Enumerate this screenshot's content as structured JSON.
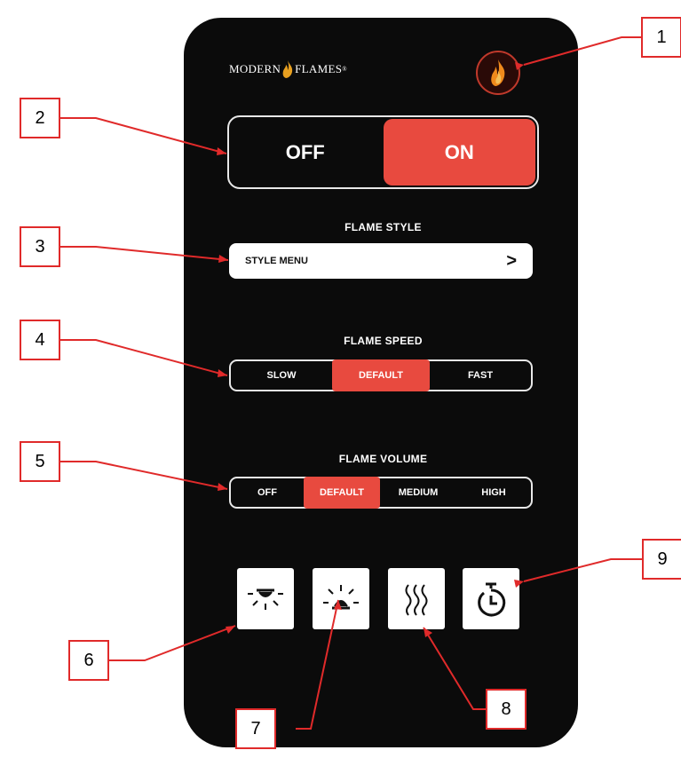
{
  "brand": {
    "left": "MODERN",
    "right": "FLAMES",
    "mark": "®"
  },
  "header": {
    "flame_button_icon": "flame-icon"
  },
  "power": {
    "off_label": "OFF",
    "on_label": "ON",
    "selected": "ON"
  },
  "flame_style": {
    "title": "FLAME STYLE",
    "menu_label": "STYLE MENU",
    "chevron": ">"
  },
  "flame_speed": {
    "title": "FLAME SPEED",
    "options": [
      "SLOW",
      "DEFAULT",
      "FAST"
    ],
    "selected": "DEFAULT"
  },
  "flame_volume": {
    "title": "FLAME VOLUME",
    "options": [
      "OFF",
      "DEFAULT",
      "MEDIUM",
      "HIGH"
    ],
    "selected": "DEFAULT"
  },
  "bottom_buttons": [
    {
      "icon": "downlight-icon"
    },
    {
      "icon": "uplight-icon"
    },
    {
      "icon": "heat-icon"
    },
    {
      "icon": "timer-icon"
    }
  ],
  "callouts": [
    "1",
    "2",
    "3",
    "4",
    "5",
    "6",
    "7",
    "8",
    "9"
  ],
  "colors": {
    "accent": "#e84a3f",
    "background": "#0b0b0b",
    "callout": "#e02a2a"
  }
}
